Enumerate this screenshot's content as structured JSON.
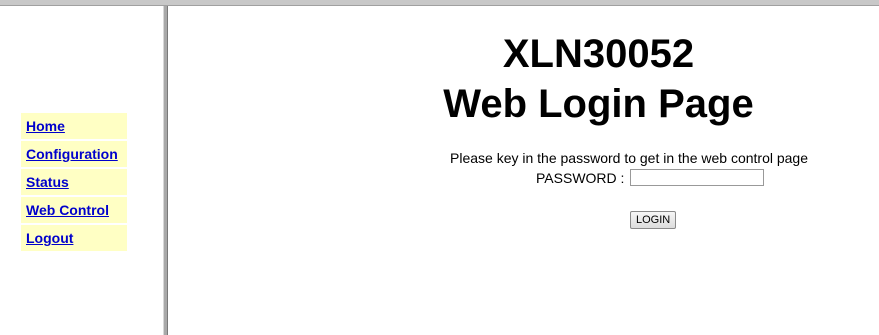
{
  "menu": {
    "items": [
      {
        "label": "Home"
      },
      {
        "label": "Configuration"
      },
      {
        "label": "Status"
      },
      {
        "label": "Web Control"
      },
      {
        "label": "Logout"
      }
    ]
  },
  "main": {
    "title_line1": "XLN30052",
    "title_line2": "Web Login Page",
    "instruction": "Please key in the password to get in the web control page",
    "password_label": "PASSWORD :",
    "password_value": "",
    "login_label": "LOGIN"
  },
  "colors": {
    "menu_bg": "#ffffc4",
    "link": "#0000cc"
  }
}
